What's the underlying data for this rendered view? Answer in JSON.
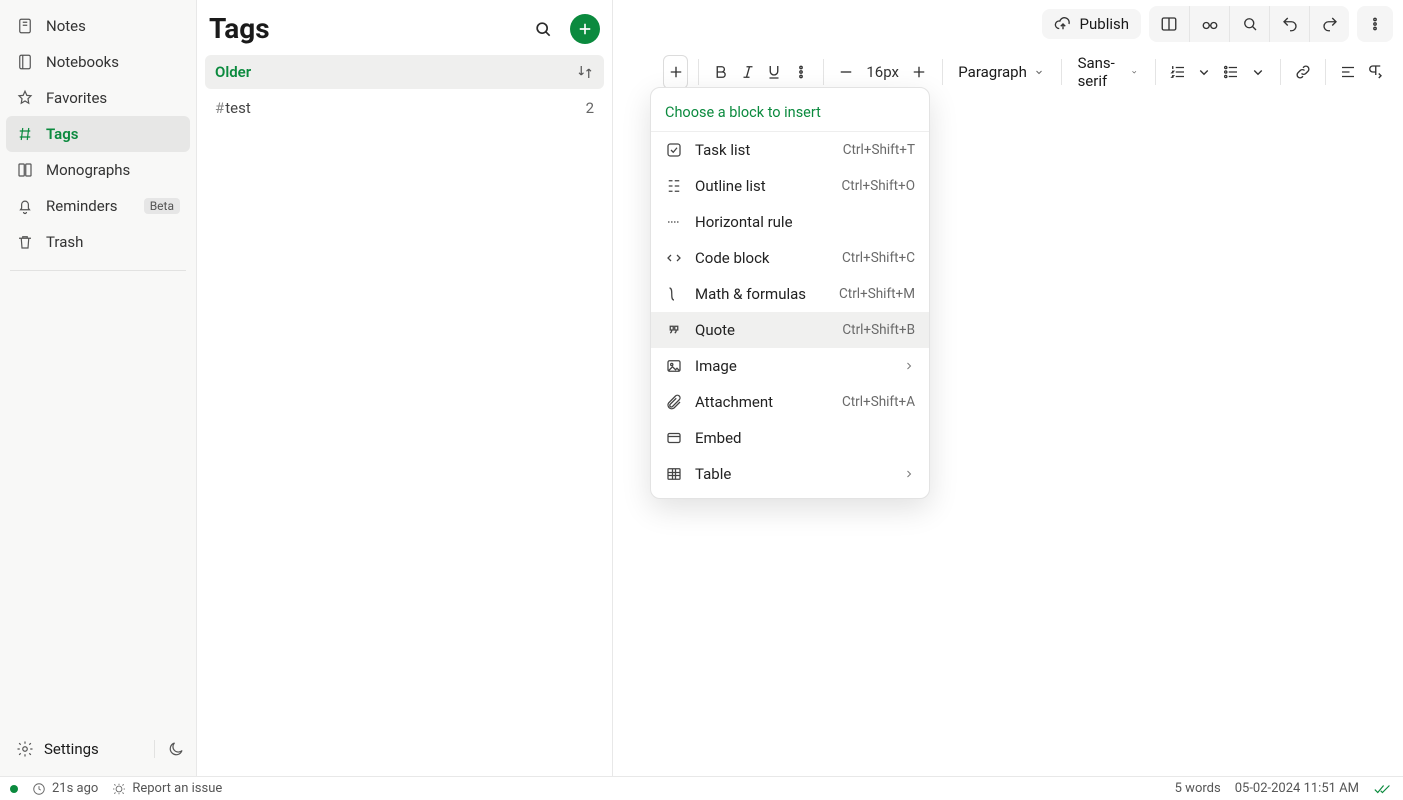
{
  "sidebar": {
    "items": [
      {
        "id": "notes",
        "label": "Notes",
        "active": false
      },
      {
        "id": "notebooks",
        "label": "Notebooks",
        "active": false
      },
      {
        "id": "favorites",
        "label": "Favorites",
        "active": false
      },
      {
        "id": "tags",
        "label": "Tags",
        "active": true
      },
      {
        "id": "monographs",
        "label": "Monographs",
        "active": false
      },
      {
        "id": "reminders",
        "label": "Reminders",
        "active": false,
        "badge": "Beta"
      },
      {
        "id": "trash",
        "label": "Trash",
        "active": false
      }
    ],
    "settings_label": "Settings"
  },
  "midcol": {
    "title": "Tags",
    "group_label": "Older",
    "tag": {
      "hash": "#",
      "name": "test",
      "count": "2"
    }
  },
  "toolbar": {
    "publish_label": "Publish",
    "font_size": "16px",
    "block_style": "Paragraph",
    "font_family": "Sans-serif"
  },
  "dropdown": {
    "header": "Choose a block to insert",
    "items": [
      {
        "id": "tasklist",
        "label": "Task list",
        "shortcut": "Ctrl+Shift+T"
      },
      {
        "id": "outline",
        "label": "Outline list",
        "shortcut": "Ctrl+Shift+O"
      },
      {
        "id": "hrule",
        "label": "Horizontal rule",
        "shortcut": ""
      },
      {
        "id": "codeblock",
        "label": "Code block",
        "shortcut": "Ctrl+Shift+C"
      },
      {
        "id": "math",
        "label": "Math & formulas",
        "shortcut": "Ctrl+Shift+M"
      },
      {
        "id": "quote",
        "label": "Quote",
        "shortcut": "Ctrl+Shift+B",
        "highlight": true
      },
      {
        "id": "image",
        "label": "Image",
        "submenu": true
      },
      {
        "id": "attachment",
        "label": "Attachment",
        "shortcut": "Ctrl+Shift+A"
      },
      {
        "id": "embed",
        "label": "Embed",
        "shortcut": ""
      },
      {
        "id": "table",
        "label": "Table",
        "submenu": true
      }
    ]
  },
  "statusbar": {
    "synced": "21s ago",
    "report": "Report an issue",
    "word_count": "5 words",
    "timestamp": "05-02-2024 11:51 AM"
  },
  "colors": {
    "accent": "#0b8a3e"
  }
}
